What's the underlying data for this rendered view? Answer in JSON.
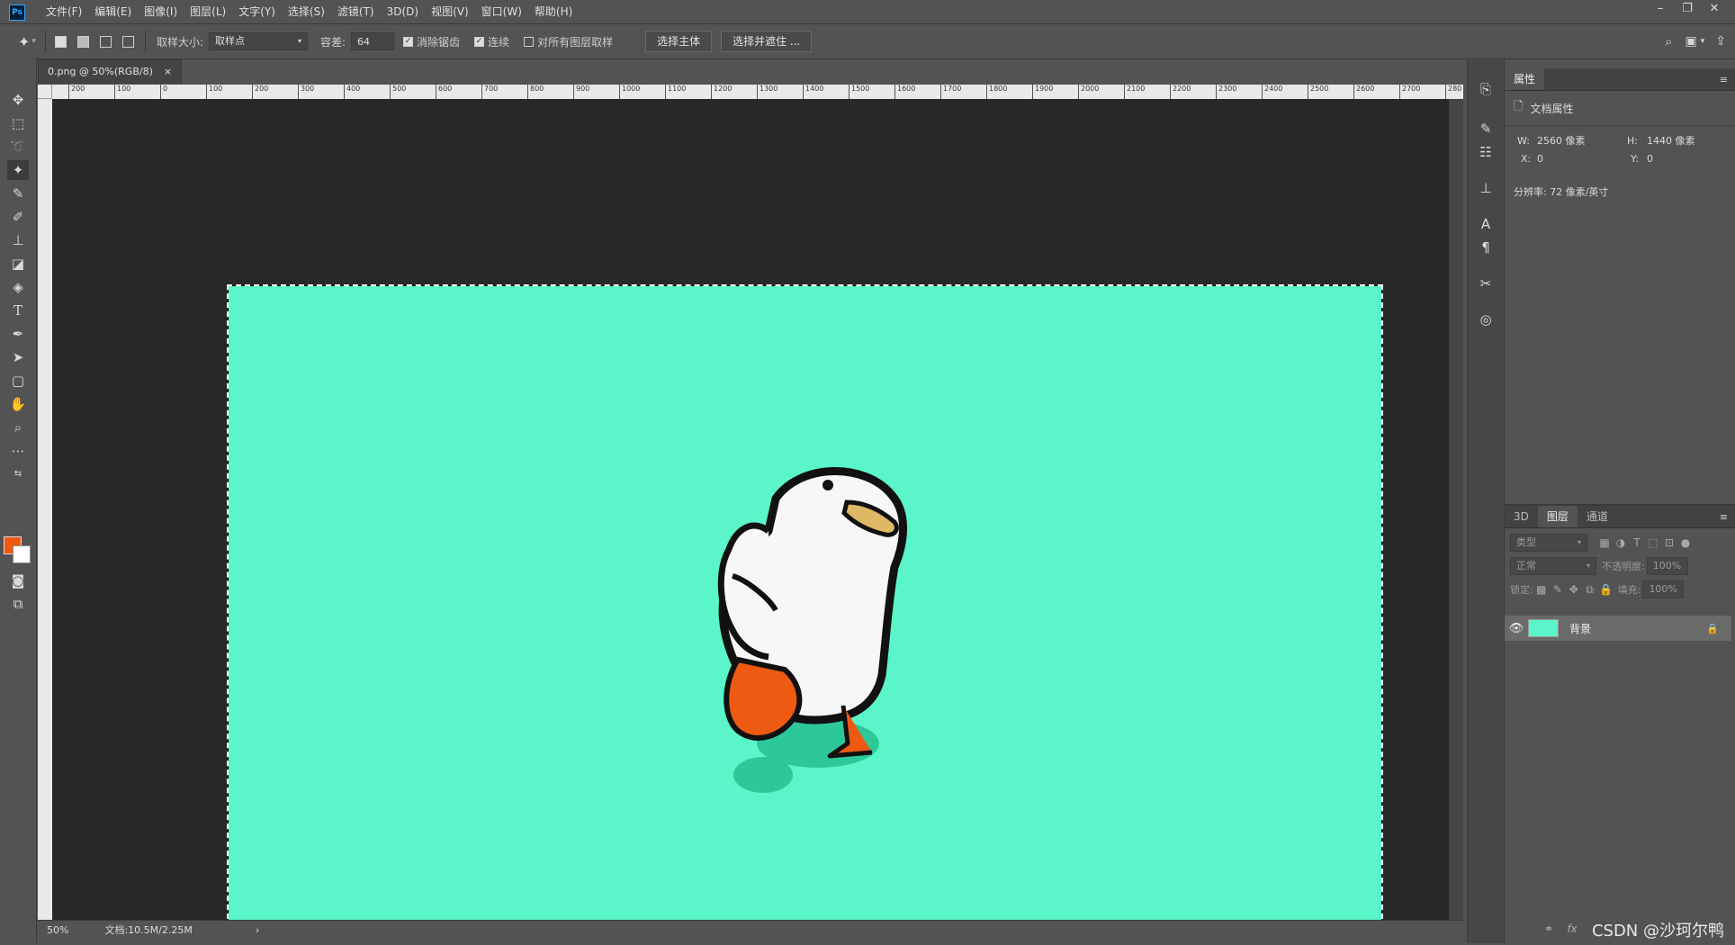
{
  "app": {
    "logo": "Ps",
    "menus": [
      "文件(F)",
      "编辑(E)",
      "图像(I)",
      "图层(L)",
      "文字(Y)",
      "选择(S)",
      "滤镜(T)",
      "3D(D)",
      "视图(V)",
      "窗口(W)",
      "帮助(H)"
    ],
    "window_controls": {
      "minimize": "–",
      "restore": "❐",
      "close": "✕"
    }
  },
  "options_bar": {
    "sample_size_label": "取样大小:",
    "sample_size_value": "取样点",
    "tolerance_label": "容差:",
    "tolerance_value": "64",
    "anti_alias_label": "消除锯齿",
    "anti_alias_checked": true,
    "contiguous_label": "连续",
    "contiguous_checked": true,
    "sample_all_layers_label": "对所有图层取样",
    "sample_all_layers_checked": false,
    "select_subject_label": "选择主体",
    "select_and_mask_label": "选择并遮住 ..."
  },
  "document": {
    "tab_title": "0.png @ 50%(RGB/8)",
    "tab_close": "×",
    "ruler_ticks": [
      "200",
      "100",
      "0",
      "100",
      "200",
      "300",
      "400",
      "500",
      "600",
      "700",
      "800",
      "900",
      "1000",
      "1100",
      "1200",
      "1300",
      "1400",
      "1500",
      "1600",
      "1700",
      "1800",
      "1900",
      "2000",
      "2100",
      "2200",
      "2300",
      "2400",
      "2500",
      "2600",
      "2700",
      "280"
    ],
    "canvas_color": "#5af5c8"
  },
  "status": {
    "zoom": "50%",
    "doc_info": "文档:10.5M/2.25M",
    "arrow": "›"
  },
  "colors": {
    "foreground": "#ee5a12",
    "background": "#ffffff"
  },
  "properties_panel": {
    "tab": "属性",
    "section": "文档属性",
    "width_label": "W:",
    "width_value": "2560 像素",
    "height_label": "H:",
    "height_value": "1440 像素",
    "x_label": "X:",
    "x_value": "0",
    "y_label": "Y:",
    "y_value": "0",
    "resolution": "分辨率: 72 像素/英寸"
  },
  "layers_panel": {
    "tabs": [
      "3D",
      "图层",
      "通道"
    ],
    "active_tab": "图层",
    "filter_placeholder": "类型",
    "blend_mode": "正常",
    "opacity_label": "不透明度:",
    "opacity_value": "100%",
    "lock_label": "锁定:",
    "fill_label": "填充:",
    "fill_value": "100%",
    "layer_name": "背景"
  },
  "watermark": "CSDN @沙珂尔鸭"
}
